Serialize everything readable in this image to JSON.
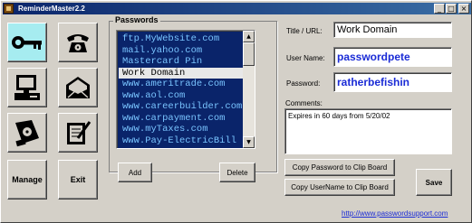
{
  "window": {
    "title": "ReminderMaster2.2",
    "min_glyph": "_",
    "max_glyph": "□",
    "close_glyph": "×"
  },
  "toolbar_icons": [
    {
      "name": "key-icon",
      "active": true
    },
    {
      "name": "telephone-icon",
      "active": false
    },
    {
      "name": "computer-icon",
      "active": false
    },
    {
      "name": "envelope-icon",
      "active": false
    },
    {
      "name": "disk-icon",
      "active": false
    },
    {
      "name": "notepad-icon",
      "active": false
    }
  ],
  "buttons": {
    "manage": "Manage",
    "exit": "Exit",
    "add": "Add",
    "delete": "Delete",
    "copy_password": "Copy Password to Clip Board",
    "copy_username": "Copy UserName to Clip Board",
    "save": "Save"
  },
  "passwords": {
    "legend": "Passwords",
    "items": [
      "ftp.MyWebsite.com",
      "mail.yahoo.com",
      "Mastercard Pin",
      "Work Domain",
      "www.ameritrade.com",
      "www.aol.com",
      "www.careerbuilder.com",
      "www.carpayment.com",
      "www.myTaxes.com",
      "www.Pay-ElectricBill"
    ],
    "selected_index": 3,
    "scroll_up_glyph": "▲",
    "scroll_down_glyph": "▼"
  },
  "details": {
    "title_label": "Title / URL:",
    "title_value": "Work Domain",
    "username_label": "User Name:",
    "username_value": "passwordpete",
    "password_label": "Password:",
    "password_value": "ratherbefishin",
    "comments_label": "Comments:",
    "comments_value": "Expires in 60 days from 5/20/02"
  },
  "footer": {
    "link": "http://www.passwordsupport.com"
  },
  "colors": {
    "list_bg": "#0a246a",
    "list_text": "#79c4ff",
    "value_text": "#1a2bd6",
    "active_icon_bg": "#a6ecf0"
  }
}
